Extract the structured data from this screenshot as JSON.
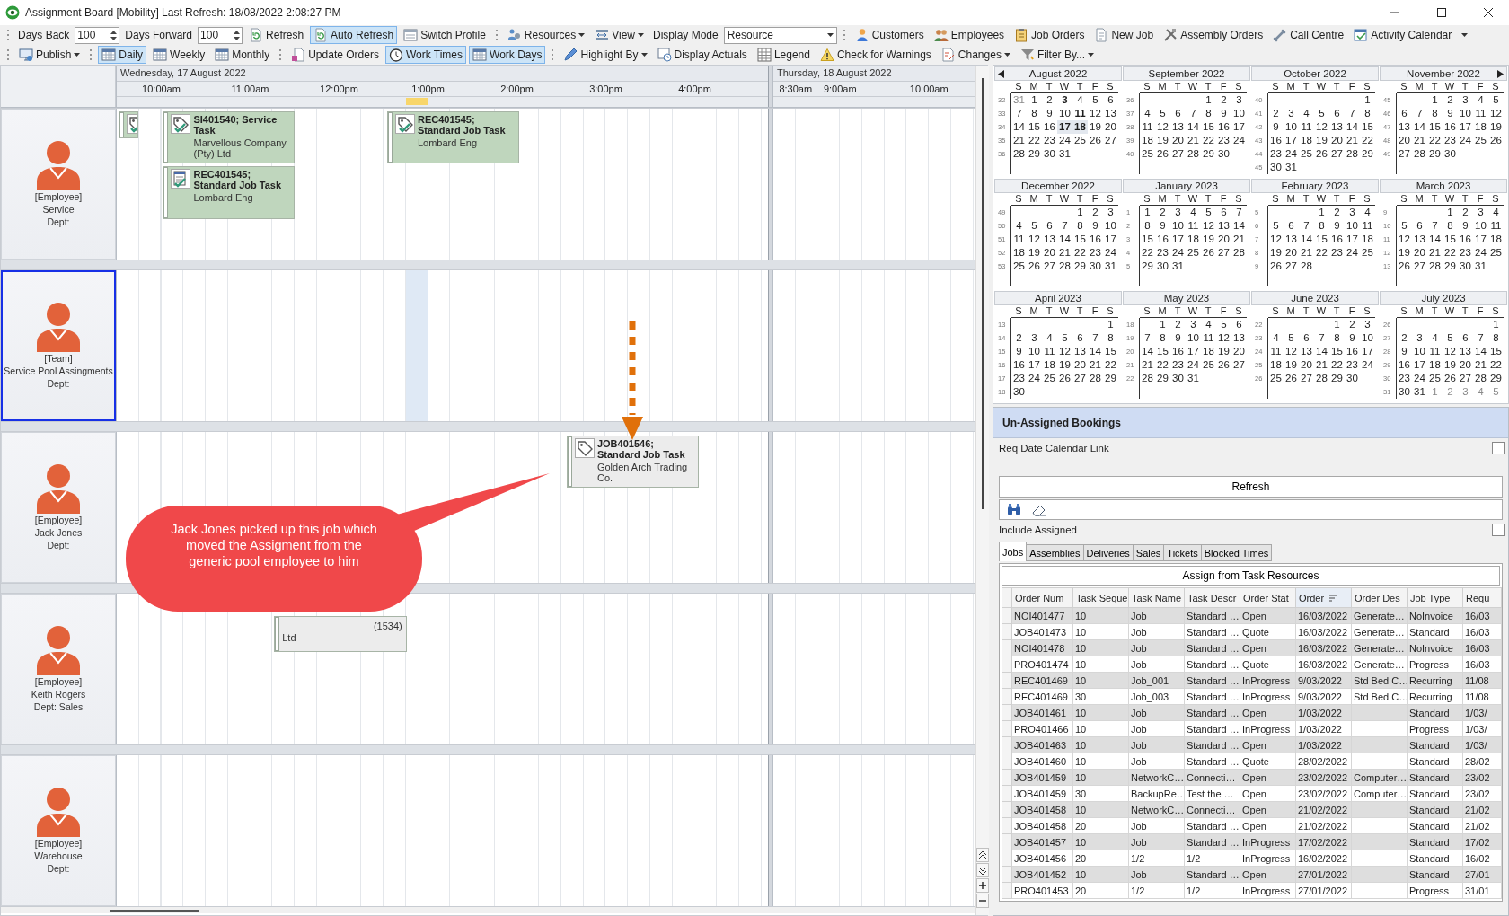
{
  "window": {
    "title": "Assignment Board [Mobility] Last Refresh: 18/08/2022 2:08:27 PM"
  },
  "toolbars": [
    {
      "items": [
        {
          "kind": "grip"
        },
        {
          "kind": "label",
          "text": "Days Back"
        },
        {
          "kind": "spin",
          "value": "100"
        },
        {
          "kind": "label",
          "text": "Days Forward"
        },
        {
          "kind": "spin",
          "value": "100"
        },
        {
          "kind": "button",
          "label": "Refresh",
          "pressed": false
        },
        {
          "kind": "button",
          "label": "Auto Refresh",
          "pressed": true
        },
        {
          "kind": "button",
          "label": "Switch Profile",
          "pressed": false
        },
        {
          "kind": "grip"
        },
        {
          "kind": "menu",
          "label": "Resources"
        },
        {
          "kind": "menu",
          "label": "View"
        },
        {
          "kind": "label",
          "text": "Display Mode"
        },
        {
          "kind": "combo",
          "value": "Resource"
        },
        {
          "kind": "grip"
        },
        {
          "kind": "button",
          "label": "Customers",
          "pressed": false
        },
        {
          "kind": "button",
          "label": "Employees",
          "pressed": false
        },
        {
          "kind": "button",
          "label": "Job Orders",
          "pressed": false
        },
        {
          "kind": "button",
          "label": "New Job",
          "pressed": false
        },
        {
          "kind": "button",
          "label": "Assembly Orders",
          "pressed": false
        },
        {
          "kind": "button",
          "label": "Call Centre",
          "pressed": false
        },
        {
          "kind": "button",
          "label": "Activity Calendar",
          "pressed": false
        },
        {
          "kind": "overflow"
        }
      ]
    },
    {
      "items": [
        {
          "kind": "grip"
        },
        {
          "kind": "menu",
          "label": "Publish"
        },
        {
          "kind": "grip"
        },
        {
          "kind": "button",
          "label": "Daily",
          "pressed": true
        },
        {
          "kind": "button",
          "label": "Weekly",
          "pressed": false
        },
        {
          "kind": "button",
          "label": "Monthly",
          "pressed": false
        },
        {
          "kind": "grip"
        },
        {
          "kind": "button",
          "label": "Update Orders",
          "pressed": false
        },
        {
          "kind": "button",
          "label": "Work Times",
          "pressed": true
        },
        {
          "kind": "button",
          "label": "Work Days",
          "pressed": true
        },
        {
          "kind": "grip"
        },
        {
          "kind": "menu",
          "label": "Highlight By"
        },
        {
          "kind": "button",
          "label": "Display Actuals",
          "pressed": false
        },
        {
          "kind": "button",
          "label": "Legend",
          "pressed": false
        },
        {
          "kind": "button",
          "label": "Check for Warnings",
          "pressed": false
        },
        {
          "kind": "menu",
          "label": "Changes"
        },
        {
          "kind": "menu",
          "label": "Filter By..."
        }
      ]
    }
  ],
  "schedule": {
    "days": [
      {
        "label": "Wednesday, 17 August 2022",
        "times": [
          "10:00am",
          "11:00am",
          "12:00pm",
          "1:00pm",
          "2:00pm",
          "3:00pm",
          "4:00pm"
        ]
      },
      {
        "label": "Thursday, 18 August 2022",
        "times": [
          "8:30am",
          "9:00am",
          "10:00am"
        ]
      }
    ],
    "resources": [
      {
        "type": "[Employee]",
        "name": "Service",
        "dept": "Dept:",
        "selected": false,
        "bookings": [
          {
            "kind": "tag",
            "checked": true,
            "color": "#bfd6bd"
          },
          {
            "kind": "tag",
            "checked": true,
            "color": "#bfd6bd",
            "title": "SI401540; Service Task",
            "client": "Marvellous Company (Pty) Ltd"
          },
          {
            "kind": "document",
            "checked": true,
            "color": "#bfd6bd",
            "title": "REC401545; Standard Job Task",
            "client": "Lombard Eng"
          },
          {
            "kind": "tag",
            "checked": true,
            "color": "#bfd6bd",
            "title": "REC401545; Standard Job Task",
            "client": "Lombard Eng"
          }
        ]
      },
      {
        "type": "[Team]",
        "name": "Service Pool Assingments",
        "dept": "Dept:",
        "selected": true
      },
      {
        "type": "[Employee]",
        "name": "Jack Jones",
        "dept": "Dept:",
        "selected": false,
        "bookings": [
          {
            "kind": "tag",
            "checked": false,
            "color": "#ececec",
            "title": "JOB401546; Standard Job Task",
            "client": "Golden Arch Trading Co."
          }
        ]
      },
      {
        "type": "[Employee]",
        "name": "Keith Rogers",
        "dept": "Dept: Sales",
        "selected": false,
        "bookings": [
          {
            "kind": "covered",
            "color": "#ececec",
            "lines": [
              "(1534)",
              "Ltd"
            ]
          }
        ]
      },
      {
        "type": "[Employee]",
        "name": "Warehouse",
        "dept": "Dept:",
        "selected": false
      }
    ],
    "callout": {
      "text": "Jack Jones picked up this job which moved the Assigment from the generic pool employee to him"
    }
  },
  "calendar": {
    "months": [
      {
        "title": "August 2022",
        "weekdays": [
          "S",
          "M",
          "T",
          "W",
          "T",
          "F",
          "S"
        ],
        "weeks": [
          {
            "week": "32",
            "days": [
              {
                "day": "31",
                "other_month": true
              },
              "1",
              "2",
              {
                "day": "3",
                "bold": true
              },
              "4",
              "5",
              "6"
            ]
          },
          {
            "week": "33",
            "days": [
              "7",
              "8",
              "9",
              "10",
              {
                "day": "11",
                "bold": true
              },
              "12",
              "13"
            ]
          },
          {
            "week": "34",
            "days": [
              "14",
              "15",
              "16",
              {
                "day": "17",
                "bold": true,
                "selected": true
              },
              {
                "day": "18",
                "bold": true,
                "selected": true
              },
              "19",
              "20"
            ]
          },
          {
            "week": "35",
            "days": [
              "21",
              "22",
              "23",
              "24",
              "25",
              "26",
              "27"
            ]
          },
          {
            "week": "36",
            "days": [
              "28",
              "29",
              "30",
              "31"
            ]
          }
        ]
      },
      {
        "title": "September 2022",
        "weekdays": [
          "S",
          "M",
          "T",
          "W",
          "T",
          "F",
          "S"
        ],
        "weeks": [
          {
            "week": "36",
            "days": [
              "1",
              "2",
              "3"
            ]
          },
          {
            "week": "37",
            "days": [
              "4",
              "5",
              "6",
              "7",
              "8",
              "9",
              "10"
            ]
          },
          {
            "week": "38",
            "days": [
              "11",
              "12",
              "13",
              "14",
              "15",
              "16",
              "17"
            ]
          },
          {
            "week": "39",
            "days": [
              "18",
              "19",
              "20",
              "21",
              "22",
              "23",
              "24"
            ]
          },
          {
            "week": "40",
            "days": [
              "25",
              "26",
              "27",
              "28",
              "29",
              "30"
            ]
          }
        ]
      },
      {
        "title": "October 2022",
        "weekdays": [
          "S",
          "M",
          "T",
          "W",
          "T",
          "F",
          "S"
        ],
        "weeks": [
          {
            "week": "40",
            "days": [
              "1"
            ]
          },
          {
            "week": "41",
            "days": [
              "2",
              "3",
              "4",
              "5",
              "6",
              "7",
              "8"
            ]
          },
          {
            "week": "42",
            "days": [
              "9",
              "10",
              "11",
              "12",
              "13",
              "14",
              "15"
            ]
          },
          {
            "week": "43",
            "days": [
              "16",
              "17",
              "18",
              "19",
              "20",
              "21",
              "22"
            ]
          },
          {
            "week": "44",
            "days": [
              "23",
              "24",
              "25",
              "26",
              "27",
              "28",
              "29"
            ]
          },
          {
            "week": "45",
            "days": [
              "30",
              "31"
            ]
          }
        ]
      },
      {
        "title": "November 2022",
        "weekdays": [
          "S",
          "M",
          "T",
          "W",
          "T",
          "F",
          "S"
        ],
        "weeks": [
          {
            "week": "45",
            "days": [
              "1",
              "2",
              "3",
              "4",
              "5"
            ]
          },
          {
            "week": "46",
            "days": [
              "6",
              "7",
              "8",
              "9",
              "10",
              "11",
              "12"
            ]
          },
          {
            "week": "47",
            "days": [
              "13",
              "14",
              "15",
              "16",
              "17",
              "18",
              "19"
            ]
          },
          {
            "week": "48",
            "days": [
              "20",
              "21",
              "22",
              "23",
              "24",
              "25",
              "26"
            ]
          },
          {
            "week": "49",
            "days": [
              "27",
              "28",
              "29",
              "30"
            ]
          }
        ]
      },
      {
        "title": "December 2022",
        "weekdays": [
          "S",
          "M",
          "T",
          "W",
          "T",
          "F",
          "S"
        ],
        "weeks": [
          {
            "week": "49",
            "days": [
              "1",
              "2",
              "3"
            ]
          },
          {
            "week": "50",
            "days": [
              "4",
              "5",
              "6",
              "7",
              "8",
              "9",
              "10"
            ]
          },
          {
            "week": "51",
            "days": [
              "11",
              "12",
              "13",
              "14",
              "15",
              "16",
              "17"
            ]
          },
          {
            "week": "52",
            "days": [
              "18",
              "19",
              "20",
              "21",
              "22",
              "23",
              "24"
            ]
          },
          {
            "week": "53",
            "days": [
              "25",
              "26",
              "27",
              "28",
              "29",
              "30",
              "31"
            ]
          }
        ]
      },
      {
        "title": "January 2023",
        "weekdays": [
          "S",
          "M",
          "T",
          "W",
          "T",
          "F",
          "S"
        ],
        "weeks": [
          {
            "week": "1",
            "days": [
              "1",
              "2",
              "3",
              "4",
              "5",
              "6",
              "7"
            ]
          },
          {
            "week": "2",
            "days": [
              "8",
              "9",
              "10",
              "11",
              "12",
              "13",
              "14"
            ]
          },
          {
            "week": "3",
            "days": [
              "15",
              "16",
              "17",
              "18",
              "19",
              "20",
              "21"
            ]
          },
          {
            "week": "4",
            "days": [
              "22",
              "23",
              "24",
              "25",
              "26",
              "27",
              "28"
            ]
          },
          {
            "week": "5",
            "days": [
              "29",
              "30",
              "31"
            ]
          }
        ]
      },
      {
        "title": "February 2023",
        "weekdays": [
          "S",
          "M",
          "T",
          "W",
          "T",
          "F",
          "S"
        ],
        "weeks": [
          {
            "week": "5",
            "days": [
              "1",
              "2",
              "3",
              "4"
            ]
          },
          {
            "week": "6",
            "days": [
              "5",
              "6",
              "7",
              "8",
              "9",
              "10",
              "11"
            ]
          },
          {
            "week": "7",
            "days": [
              "12",
              "13",
              "14",
              "15",
              "16",
              "17",
              "18"
            ]
          },
          {
            "week": "8",
            "days": [
              "19",
              "20",
              "21",
              "22",
              "23",
              "24",
              "25"
            ]
          },
          {
            "week": "9",
            "days": [
              "26",
              "27",
              "28"
            ]
          }
        ]
      },
      {
        "title": "March 2023",
        "weekdays": [
          "S",
          "M",
          "T",
          "W",
          "T",
          "F",
          "S"
        ],
        "weeks": [
          {
            "week": "9",
            "days": [
              "1",
              "2",
              "3",
              "4"
            ]
          },
          {
            "week": "10",
            "days": [
              "5",
              "6",
              "7",
              "8",
              "9",
              "10",
              "11"
            ]
          },
          {
            "week": "11",
            "days": [
              "12",
              "13",
              "14",
              "15",
              "16",
              "17",
              "18"
            ]
          },
          {
            "week": "12",
            "days": [
              "19",
              "20",
              "21",
              "22",
              "23",
              "24",
              "25"
            ]
          },
          {
            "week": "13",
            "days": [
              "26",
              "27",
              "28",
              "29",
              "30",
              "31"
            ]
          }
        ]
      },
      {
        "title": "April 2023",
        "weekdays": [
          "S",
          "M",
          "T",
          "W",
          "T",
          "F",
          "S"
        ],
        "weeks": [
          {
            "week": "13",
            "days": [
              "1"
            ]
          },
          {
            "week": "14",
            "days": [
              "2",
              "3",
              "4",
              "5",
              "6",
              "7",
              "8"
            ]
          },
          {
            "week": "15",
            "days": [
              "9",
              "10",
              "11",
              "12",
              "13",
              "14",
              "15"
            ]
          },
          {
            "week": "16",
            "days": [
              "16",
              "17",
              "18",
              "19",
              "20",
              "21",
              "22"
            ]
          },
          {
            "week": "17",
            "days": [
              "23",
              "24",
              "25",
              "26",
              "27",
              "28",
              "29"
            ]
          },
          {
            "week": "18",
            "days": [
              "30"
            ]
          }
        ]
      },
      {
        "title": "May 2023",
        "weekdays": [
          "S",
          "M",
          "T",
          "W",
          "T",
          "F",
          "S"
        ],
        "weeks": [
          {
            "week": "18",
            "days": [
              "1",
              "2",
              "3",
              "4",
              "5",
              "6"
            ]
          },
          {
            "week": "19",
            "days": [
              "7",
              "8",
              "9",
              "10",
              "11",
              "12",
              "13"
            ]
          },
          {
            "week": "20",
            "days": [
              "14",
              "15",
              "16",
              "17",
              "18",
              "19",
              "20"
            ]
          },
          {
            "week": "21",
            "days": [
              "21",
              "22",
              "23",
              "24",
              "25",
              "26",
              "27"
            ]
          },
          {
            "week": "22",
            "days": [
              "28",
              "29",
              "30",
              "31"
            ]
          }
        ]
      },
      {
        "title": "June 2023",
        "weekdays": [
          "S",
          "M",
          "T",
          "W",
          "T",
          "F",
          "S"
        ],
        "weeks": [
          {
            "week": "22",
            "days": [
              "1",
              "2",
              "3"
            ]
          },
          {
            "week": "23",
            "days": [
              "4",
              "5",
              "6",
              "7",
              "8",
              "9",
              "10"
            ]
          },
          {
            "week": "24",
            "days": [
              "11",
              "12",
              "13",
              "14",
              "15",
              "16",
              "17"
            ]
          },
          {
            "week": "25",
            "days": [
              "18",
              "19",
              "20",
              "21",
              "22",
              "23",
              "24"
            ]
          },
          {
            "week": "26",
            "days": [
              "25",
              "26",
              "27",
              "28",
              "29",
              "30"
            ]
          }
        ]
      },
      {
        "title": "July 2023",
        "weekdays": [
          "S",
          "M",
          "T",
          "W",
          "T",
          "F",
          "S"
        ],
        "weeks": [
          {
            "week": "26",
            "days": [
              "1"
            ]
          },
          {
            "week": "27",
            "days": [
              "2",
              "3",
              "4",
              "5",
              "6",
              "7",
              "8"
            ]
          },
          {
            "week": "28",
            "days": [
              "9",
              "10",
              "11",
              "12",
              "13",
              "14",
              "15"
            ]
          },
          {
            "week": "29",
            "days": [
              "16",
              "17",
              "18",
              "19",
              "20",
              "21",
              "22"
            ]
          },
          {
            "week": "30",
            "days": [
              "23",
              "24",
              "25",
              "26",
              "27",
              "28",
              "29"
            ]
          },
          {
            "week": "31",
            "days": [
              "30",
              "31",
              {
                "day": "1",
                "other_month": true
              },
              {
                "day": "2",
                "other_month": true
              },
              {
                "day": "3",
                "other_month": true
              },
              {
                "day": "4",
                "other_month": true
              },
              {
                "day": "5",
                "other_month": true
              }
            ]
          }
        ]
      }
    ]
  },
  "unassigned": {
    "title": "Un-Assigned Bookings",
    "calendar_link": {
      "label": "Req Date Calendar Link",
      "checked": false
    },
    "refresh_button": "Refresh",
    "include_assigned": {
      "label": "Include Assigned",
      "checked": false
    },
    "tabs": [
      {
        "label": "Jobs",
        "selected": true
      },
      {
        "label": "Assemblies",
        "selected": false
      },
      {
        "label": "Deliveries",
        "selected": false
      },
      {
        "label": "Sales",
        "selected": false
      },
      {
        "label": "Tickets",
        "selected": false
      },
      {
        "label": "Blocked Times",
        "selected": false
      }
    ],
    "assign_button": "Assign from Task Resources",
    "table": {
      "columns": [
        {
          "label": "Order Num",
          "sorted": false
        },
        {
          "label": "Task Seque",
          "sorted": false
        },
        {
          "label": "Task Name",
          "sorted": false
        },
        {
          "label": "Task Descr",
          "sorted": false
        },
        {
          "label": "Order Stat",
          "sorted": false
        },
        {
          "label": "Order",
          "sorted": true
        },
        {
          "label": "Order Des",
          "sorted": false
        },
        {
          "label": "Job Type",
          "sorted": false
        },
        {
          "label": "Requ",
          "sorted": false
        }
      ],
      "rows": [
        [
          "NOI401477",
          "10",
          "Job",
          "Standard …",
          "Open",
          "16/03/2022",
          "Generate…",
          "NoInvoice",
          "16/03"
        ],
        [
          "JOB401473",
          "10",
          "Job",
          "Standard …",
          "Quote",
          "16/03/2022",
          "Generate…",
          "Standard",
          "16/03"
        ],
        [
          "NOI401478",
          "10",
          "Job",
          "Standard …",
          "Open",
          "16/03/2022",
          "Generate…",
          "NoInvoice",
          "16/03"
        ],
        [
          "PRO401474",
          "10",
          "Job",
          "Standard …",
          "Quote",
          "16/03/2022",
          "Generate…",
          "Progress",
          "16/03"
        ],
        [
          "REC401469",
          "10",
          "Job_001",
          "Standard …",
          "InProgress",
          "9/03/2022",
          "Std Bed C…",
          "Recurring",
          "11/08"
        ],
        [
          "REC401469",
          "30",
          "Job_003",
          "Standard …",
          "InProgress",
          "9/03/2022",
          "Std Bed C…",
          "Recurring",
          "11/08"
        ],
        [
          "JOB401461",
          "10",
          "Job",
          "Standard …",
          "Open",
          "1/03/2022",
          null,
          "Standard",
          "1/03/"
        ],
        [
          "PRO401466",
          "10",
          "Job",
          "Standard …",
          "InProgress",
          "1/03/2022",
          null,
          "Progress",
          "1/03/"
        ],
        [
          "JOB401463",
          "10",
          "Job",
          "Standard …",
          "Open",
          "1/03/2022",
          null,
          "Standard",
          "1/03/"
        ],
        [
          "JOB401460",
          "10",
          "Job",
          "Standard …",
          "Quote",
          "28/02/2022",
          null,
          "Standard",
          "28/02"
        ],
        [
          "JOB401459",
          "10",
          "NetworkC…",
          "Connecti…",
          "Open",
          "23/02/2022",
          "Computer…",
          "Standard",
          "23/02"
        ],
        [
          "JOB401459",
          "30",
          "BackupRe…",
          "Test the …",
          "Open",
          "23/02/2022",
          "Computer…",
          "Standard",
          "23/02"
        ],
        [
          "JOB401458",
          "10",
          "NetworkC…",
          "Connecti…",
          "Open",
          "21/02/2022",
          null,
          "Standard",
          "21/02"
        ],
        [
          "JOB401458",
          "20",
          "Job",
          "Standard …",
          "Open",
          "21/02/2022",
          null,
          "Standard",
          "21/02"
        ],
        [
          "JOB401457",
          "10",
          "Job",
          "Standard …",
          "InProgress",
          "17/02/2022",
          null,
          "Standard",
          "17/02"
        ],
        [
          "JOB401456",
          "20",
          "1/2",
          "1/2",
          "InProgress",
          "16/02/2022",
          null,
          "Standard",
          "16/02"
        ],
        [
          "JOB401452",
          "10",
          "Job",
          "Standard …",
          "Open",
          "27/01/2022",
          null,
          "Standard",
          "27/01"
        ],
        [
          "PRO401453",
          "20",
          "1/2",
          "1/2",
          "InProgress",
          "27/01/2022",
          null,
          "Progress",
          "31/01"
        ]
      ]
    }
  }
}
